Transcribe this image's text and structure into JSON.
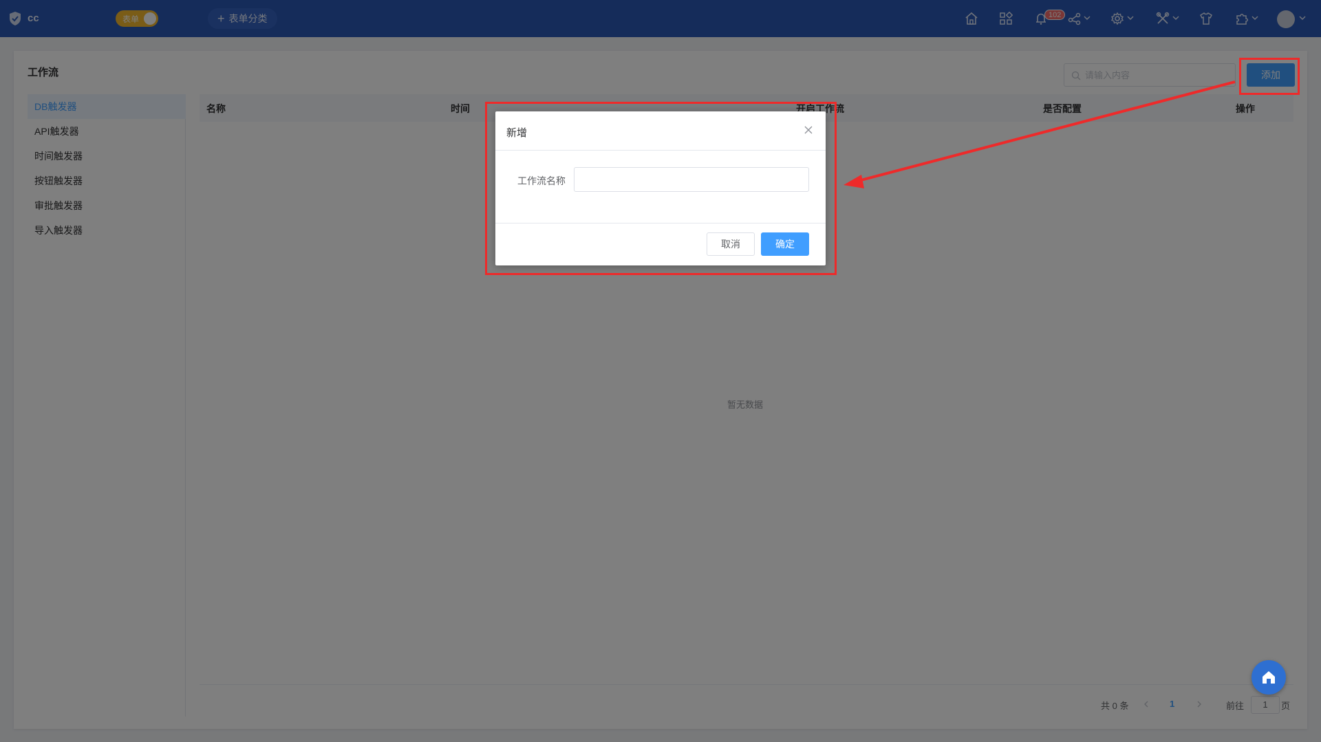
{
  "header": {
    "app_name": "cc",
    "mode_toggle_label": "表单",
    "category_button_label": "表单分类",
    "notification_count": "102",
    "icons": [
      "home-icon",
      "apps-icon",
      "bell-icon",
      "share-icon",
      "gear-icon",
      "tools-icon",
      "shirt-icon",
      "plugin-icon"
    ]
  },
  "page": {
    "title": "工作流",
    "search_placeholder": "请输入内容",
    "add_button_label": "添加"
  },
  "sidebar": {
    "items": [
      {
        "label": "DB触发器",
        "active": true
      },
      {
        "label": "API触发器"
      },
      {
        "label": "时间触发器"
      },
      {
        "label": "按钮触发器"
      },
      {
        "label": "审批触发器"
      },
      {
        "label": "导入触发器"
      }
    ]
  },
  "table": {
    "columns": [
      "名称",
      "时间",
      "开启工作流",
      "是否配置",
      "操作"
    ],
    "empty_text": "暂无数据"
  },
  "pagination": {
    "total_text": "共 0 条",
    "current_page": "1",
    "goto_label": "前往",
    "goto_value": "1",
    "page_suffix": "页"
  },
  "dialog": {
    "title": "新增",
    "field_label": "工作流名称",
    "field_value": "",
    "cancel_label": "取消",
    "confirm_label": "确定"
  },
  "colors": {
    "header_bg": "#2b58b5",
    "primary": "#409eff",
    "annotation": "#ee2a2a",
    "toggle": "#f5b82e"
  }
}
